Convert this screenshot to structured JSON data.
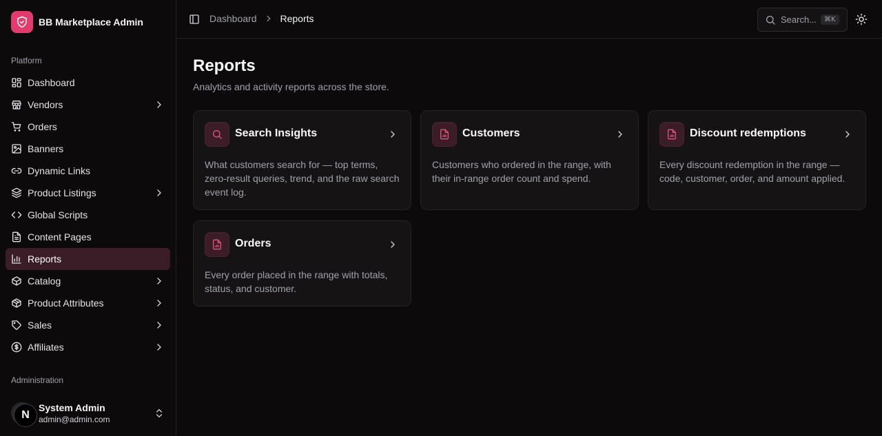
{
  "app": {
    "name": "BB Marketplace Admin",
    "logo_icon": "shield-icon",
    "accent": "#e43b6f"
  },
  "sidebar": {
    "group_platform": "Platform",
    "group_admin": "Administration",
    "items": [
      {
        "label": "Dashboard",
        "icon": "layout-dashboard-icon",
        "chevron": false
      },
      {
        "label": "Vendors",
        "icon": "store-icon",
        "chevron": true
      },
      {
        "label": "Orders",
        "icon": "shopping-cart-icon",
        "chevron": false
      },
      {
        "label": "Banners",
        "icon": "image-icon",
        "chevron": false
      },
      {
        "label": "Dynamic Links",
        "icon": "link-icon",
        "chevron": false
      },
      {
        "label": "Product Listings",
        "icon": "layers-icon",
        "chevron": true
      },
      {
        "label": "Global Scripts",
        "icon": "code-icon",
        "chevron": false
      },
      {
        "label": "Content Pages",
        "icon": "file-text-icon",
        "chevron": false
      },
      {
        "label": "Reports",
        "icon": "bar-chart-icon",
        "chevron": false,
        "active": true
      },
      {
        "label": "Catalog",
        "icon": "box-icon",
        "chevron": true
      },
      {
        "label": "Product Attributes",
        "icon": "package-icon",
        "chevron": true
      },
      {
        "label": "Sales",
        "icon": "tag-icon",
        "chevron": true
      },
      {
        "label": "Affiliates",
        "icon": "dollar-circle-icon",
        "chevron": true
      }
    ],
    "user": {
      "name": "System Admin",
      "email": "admin@admin.com",
      "badge": "N"
    }
  },
  "header": {
    "breadcrumb": [
      "Dashboard",
      "Reports"
    ],
    "search_placeholder": "Search...",
    "search_shortcut": "⌘K"
  },
  "main": {
    "title": "Reports",
    "subtitle": "Analytics and activity reports across the store.",
    "cards": [
      {
        "title": "Search Insights",
        "icon": "search-icon",
        "description": "What customers search for — top terms, zero-result queries, trend, and the raw search event log."
      },
      {
        "title": "Customers",
        "icon": "file-chart-icon",
        "description": "Customers who ordered in the range, with their in-range order count and spend."
      },
      {
        "title": "Discount redemptions",
        "icon": "file-chart-icon",
        "description": "Every discount redemption in the range — code, customer, order, and amount applied."
      },
      {
        "title": "Orders",
        "icon": "file-chart-icon",
        "description": "Every order placed in the range with totals, status, and customer."
      }
    ]
  }
}
